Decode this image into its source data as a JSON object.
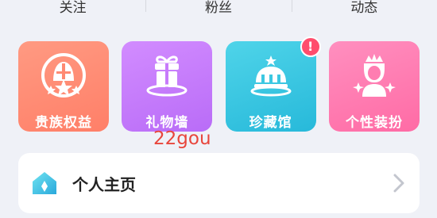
{
  "stats": {
    "follow_label": "关注",
    "fans_label": "粉丝",
    "dynamic_label": "动态"
  },
  "tiles": [
    {
      "label": "贵族权益",
      "icon": "knight-helmet-icon"
    },
    {
      "label": "礼物墙",
      "icon": "gift-icon"
    },
    {
      "label": "珍藏馆",
      "icon": "museum-icon"
    },
    {
      "label": "个性装扮",
      "icon": "princess-icon"
    }
  ],
  "badge_text": "!",
  "watermark": "22gou",
  "homepage": {
    "label": "个人主页",
    "icon": "house-icon"
  },
  "colors": {
    "noble": "#ff8a72",
    "gift_wall": "#c77bfb",
    "collection": "#3cc8e2",
    "dressup": "#ff7db1",
    "badge": "#ff4d6d"
  }
}
